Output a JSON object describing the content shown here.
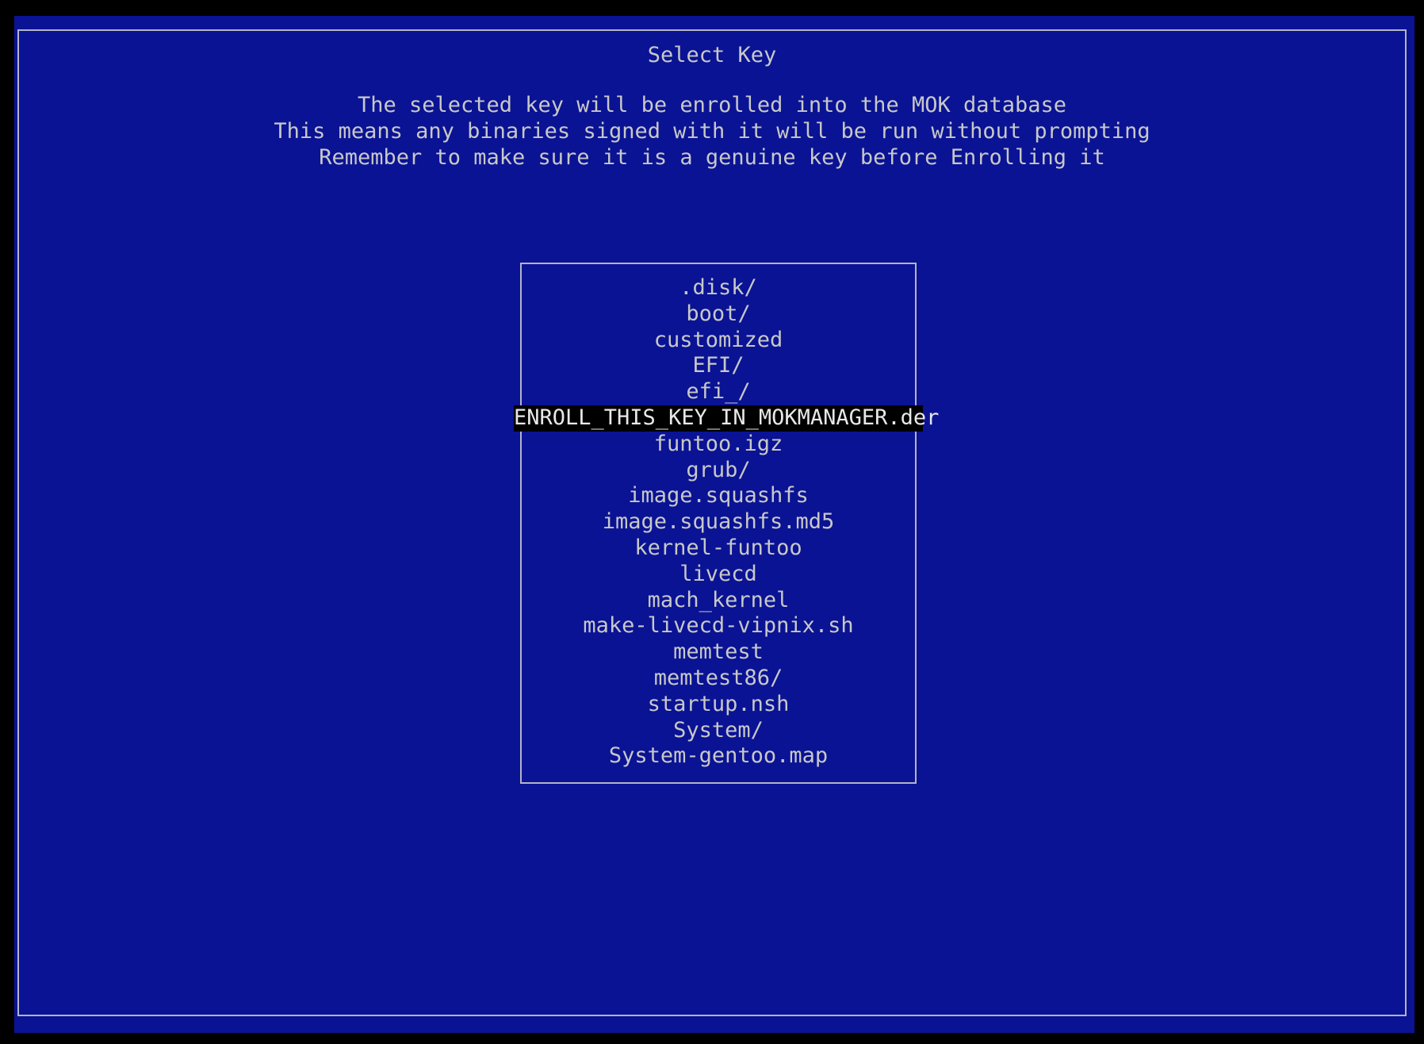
{
  "title": "Select Key",
  "description": [
    "The selected key will be enrolled into the MOK database",
    "This means any binaries signed with it will be run without prompting",
    "Remember to make sure it is a genuine key before Enrolling it"
  ],
  "files": [
    ".disk/",
    "boot/",
    "customized",
    "EFI/",
    "efi_/",
    "ENROLL_THIS_KEY_IN_MOKMANAGER.der",
    "funtoo.igz",
    "grub/",
    "image.squashfs",
    "image.squashfs.md5",
    "kernel-funtoo",
    "livecd",
    "mach_kernel",
    "make-livecd-vipnix.sh",
    "memtest",
    "memtest86/",
    "startup.nsh",
    "System/",
    "System-gentoo.map"
  ],
  "selected_index": 5,
  "colors": {
    "background": "#0a1394",
    "text": "#c8c8c8",
    "selection": "#000000"
  }
}
